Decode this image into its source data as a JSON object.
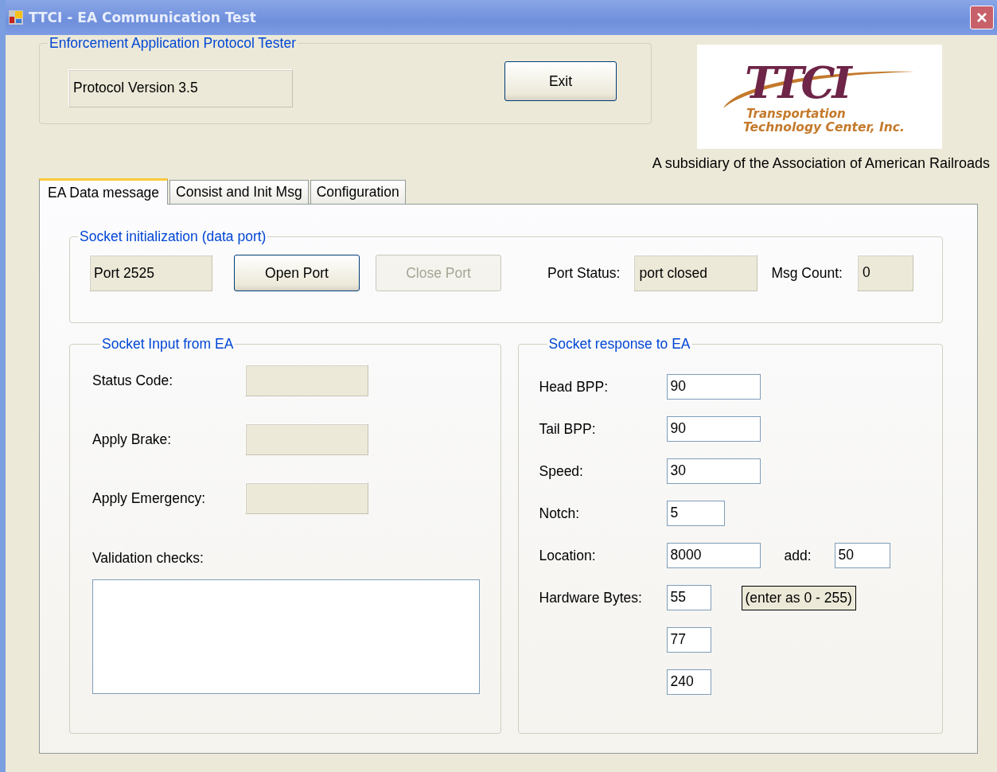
{
  "window": {
    "title": "TTCI - EA Communication Test"
  },
  "header_group": {
    "title": "Enforcement Application Protocol Tester",
    "version_field": "Protocol Version 3.5",
    "exit_button": "Exit"
  },
  "logo": {
    "mark": "TTCI",
    "line_1": "Transportation",
    "line_2": "Technology Center, Inc."
  },
  "subsidiary_note": "A subsidiary of the Association of American Railroads",
  "tabs": [
    {
      "label": "EA Data message",
      "selected": true
    },
    {
      "label": "Consist and Init Msg",
      "selected": false
    },
    {
      "label": "Configuration",
      "selected": false
    }
  ],
  "socket_init": {
    "title": "Socket initialization (data port)",
    "port_field": "Port 2525",
    "buttons": [
      {
        "label": "Open Port",
        "disabled": false
      },
      {
        "label": "Close Port",
        "disabled": true
      }
    ],
    "status_label": "Port Status:",
    "status_value": "port closed",
    "count_label": "Msg Count:",
    "count_value": "0"
  },
  "socket_input": {
    "title": "Socket Input from EA",
    "fields": [
      {
        "label": "Status Code:"
      },
      {
        "label": "Apply Brake:"
      },
      {
        "label": "Apply Emergency:"
      }
    ],
    "validation_label": "Validation checks:"
  },
  "socket_response": {
    "title": "Socket response to EA",
    "rows": [
      {
        "label": "Head BPP:",
        "value": "90",
        "kind": "wide"
      },
      {
        "label": "Tail BPP:",
        "value": "90",
        "kind": "wide"
      },
      {
        "label": "Speed:",
        "value": "30",
        "kind": "wide"
      },
      {
        "label": "Notch:",
        "value": "5",
        "kind": "medium"
      },
      {
        "label": "Location:",
        "value": "8000",
        "kind": "wide",
        "extra_label": "add:",
        "extra_value": "50"
      },
      {
        "label": "Hardware Bytes:",
        "value": "55",
        "kind": "small",
        "note": "(enter as 0 - 255)"
      },
      {
        "value": "77",
        "kind": "small"
      },
      {
        "value": "240",
        "kind": "small"
      }
    ]
  }
}
